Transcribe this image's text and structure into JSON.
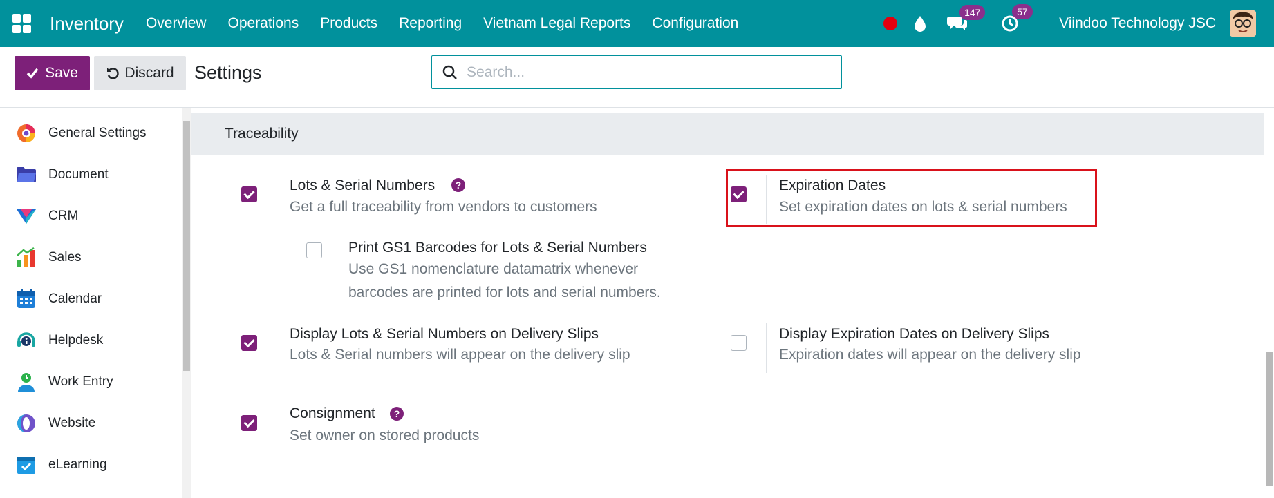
{
  "navbar": {
    "brand": "Inventory",
    "menu": [
      "Overview",
      "Operations",
      "Products",
      "Reporting",
      "Vietnam Legal Reports",
      "Configuration"
    ],
    "messages_count": "147",
    "activities_count": "57",
    "company": "Viindoo Technology JSC",
    "icons": [
      "apps-grid-icon",
      "recording-dot-icon",
      "drop-icon",
      "chat-icon",
      "clock-icon",
      "avatar"
    ]
  },
  "control": {
    "save_label": "Save",
    "discard_label": "Discard",
    "title": "Settings",
    "search_placeholder": "Search..."
  },
  "sidebar": {
    "items": [
      {
        "label": "General Settings",
        "icon": "general-settings-icon"
      },
      {
        "label": "Document",
        "icon": "folder-icon"
      },
      {
        "label": "CRM",
        "icon": "crm-icon"
      },
      {
        "label": "Sales",
        "icon": "sales-chart-icon"
      },
      {
        "label": "Calendar",
        "icon": "calendar-icon"
      },
      {
        "label": "Helpdesk",
        "icon": "helpdesk-icon"
      },
      {
        "label": "Work Entry",
        "icon": "work-entry-icon"
      },
      {
        "label": "Website",
        "icon": "website-icon"
      },
      {
        "label": "eLearning",
        "icon": "elearning-icon"
      }
    ]
  },
  "section": {
    "title": "Traceability",
    "settings": {
      "lots": {
        "title": "Lots & Serial Numbers",
        "desc": "Get a full traceability from vendors to customers",
        "checked": true
      },
      "gs1": {
        "title": "Print GS1 Barcodes for Lots & Serial Numbers",
        "desc1": "Use GS1 nomenclature datamatrix whenever",
        "desc2": "barcodes are printed for lots and serial numbers.",
        "checked": false
      },
      "expiration": {
        "title": "Expiration Dates",
        "desc": "Set expiration dates on lots & serial numbers",
        "checked": true
      },
      "lots_delivery": {
        "title": "Display Lots & Serial Numbers on Delivery Slips",
        "desc": "Lots & Serial numbers will appear on the delivery slip",
        "checked": true
      },
      "exp_delivery": {
        "title": "Display Expiration Dates on Delivery Slips",
        "desc": "Expiration dates will appear on the delivery slip",
        "checked": false
      },
      "consignment": {
        "title": "Consignment",
        "desc": "Set owner on stored products",
        "checked": true
      }
    }
  },
  "colors": {
    "navbar": "#01919c",
    "primary": "#7d2079",
    "highlight": "#d9121b"
  }
}
